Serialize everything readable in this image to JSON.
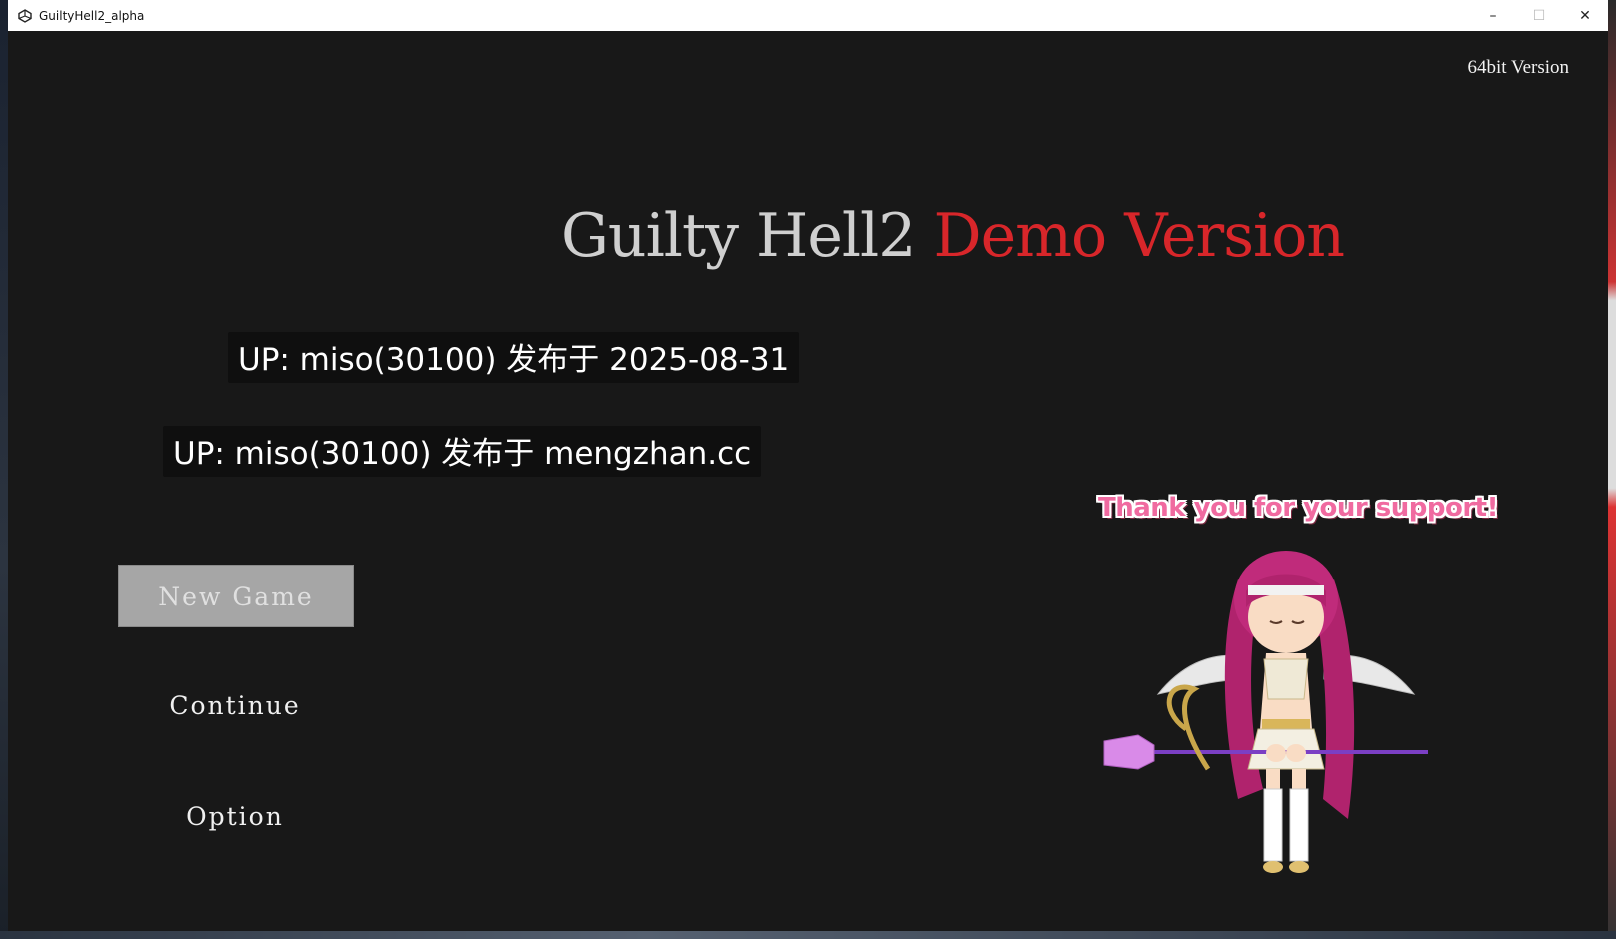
{
  "window": {
    "title": "GuiltyHell2_alpha",
    "controls": {
      "minimize": "–",
      "maximize": "☐",
      "close": "✕"
    }
  },
  "game": {
    "version": "64bit Version",
    "title_part1": "Guilty Hell2",
    "title_part2": "Demo Version",
    "up_label_1": "UP: miso(30100) 发布于 2025-08-31",
    "up_label_2": "UP: miso(30100) 发布于 mengzhan.cc",
    "menu": {
      "new_game": "New Game",
      "continue": "Continue",
      "option": "Option"
    },
    "thanks": "Thank you for your support!"
  },
  "colors": {
    "background": "#181818",
    "title_white": "#cfcfcf",
    "title_red": "#d8262a",
    "selected_button": "#a6a6a6",
    "thanks_pink": "#f06aa0"
  },
  "icons": {
    "app": "unity-icon",
    "mascot": "angel-girl-illustration"
  }
}
